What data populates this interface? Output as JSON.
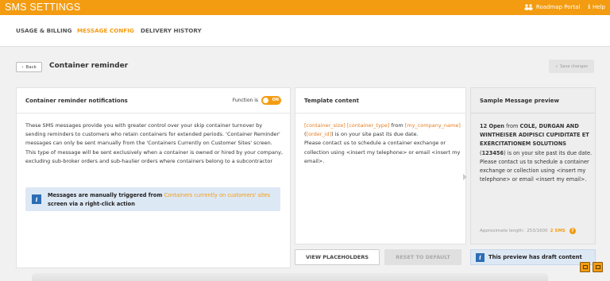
{
  "app": {
    "title": "SMS SETTINGS"
  },
  "topbar": {
    "roadmap_label": "Roadmap Portal",
    "help_label": "Help"
  },
  "tabs": [
    {
      "label": "USAGE & BILLING",
      "active": false
    },
    {
      "label": "MESSAGE CONFIG",
      "active": true
    },
    {
      "label": "DELIVERY HISTORY",
      "active": false
    }
  ],
  "header": {
    "back_label": "Back",
    "title": "Container reminder",
    "save_label": "Save changes"
  },
  "notifications": {
    "heading": "Container reminder notifications",
    "function_label": "Function is",
    "toggle_label": "ON",
    "description": "These SMS messages provide you with greater control over your skip container turnover by sending reminders to customers who retain containers for extended periods. 'Container Reminder' messages can only be sent manually from the 'Containers Currently on Customer Sites' screen. This type of message will be sent exclusively when a container is owned or hired by your company, excluding sub-broker orders and sub-haulier orders where containers belong to a subcontractor",
    "info_prefix": "Messages are manually triggered from",
    "info_link": "Containers currently on customers' sites",
    "info_suffix": "screen via a right-click action"
  },
  "template": {
    "heading": "Template content",
    "ph_size": "[container_size]",
    "ph_type": "[container_type]",
    "word_from": " from",
    "ph_company": "[my_company_name]",
    "paren_open": " (",
    "ph_order": "[order_id]",
    "rest_line": ") is on your site past its due date.",
    "body": "Please contact us to schedule a container exchange or collection using <insert my telephone> or email <insert my email>."
  },
  "preview": {
    "heading": "Sample Message preview",
    "size_type": "12 Open",
    "word_from": " from ",
    "company": "COLE, DURGAN AND WINTHEISER ADIPISCI CUPIDITATE ET EXERCITATIONEM SOLUTIONS",
    "paren_open": " (",
    "order_id": "123456",
    "rest_line": ") is on your site past its due date.",
    "body": "Please contact us to schedule a container exchange or collection using <insert my telephone> or email <insert my email>.",
    "approx_label": "Approximate length:",
    "approx_count": "253/1600",
    "approx_sms": "2 SMS",
    "approx_help": "?"
  },
  "buttons": {
    "view_placeholders": "VIEW PLACEHOLDERS",
    "reset_default": "RESET TO DEFAULT"
  },
  "draft_notice": "This preview has draft content",
  "icons": [
    "roadmap-icon",
    "info-icon",
    "back-chevron-icon",
    "check-icon",
    "question-icon",
    "dock-left-icon",
    "dock-right-icon"
  ],
  "colors": {
    "accent": "#f39c12",
    "info_bg": "#dde8f5",
    "info_icon": "#2d6db5",
    "placeholder": "#e67e22"
  }
}
